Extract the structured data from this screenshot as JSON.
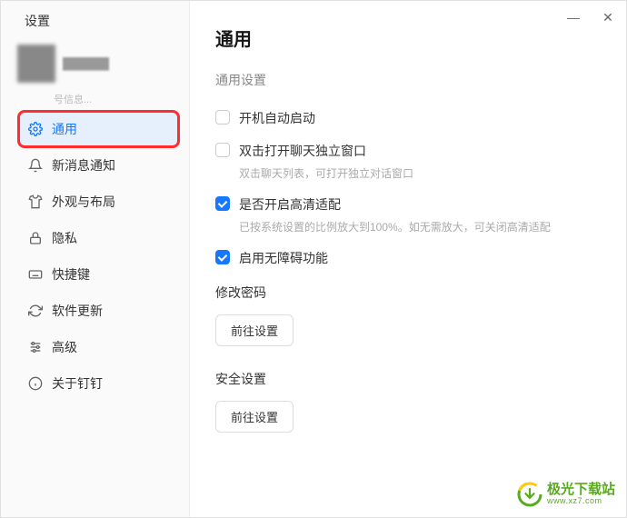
{
  "window": {
    "title": "设置",
    "minimize": "—",
    "close": "✕"
  },
  "profile": {
    "name_masked": "██████",
    "sub": "号信息..."
  },
  "sidebar": {
    "items": [
      {
        "label": "通用",
        "icon": "gear"
      },
      {
        "label": "新消息通知",
        "icon": "bell"
      },
      {
        "label": "外观与布局",
        "icon": "shirt"
      },
      {
        "label": "隐私",
        "icon": "lock"
      },
      {
        "label": "快捷键",
        "icon": "keyboard"
      },
      {
        "label": "软件更新",
        "icon": "refresh"
      },
      {
        "label": "高级",
        "icon": "sliders"
      },
      {
        "label": "关于钉钉",
        "icon": "info"
      }
    ]
  },
  "main": {
    "title": "通用",
    "section_label": "通用设置",
    "options": [
      {
        "label": "开机自动启动",
        "checked": false,
        "desc": ""
      },
      {
        "label": "双击打开聊天独立窗口",
        "checked": false,
        "desc": "双击聊天列表，可打开独立对话窗口"
      },
      {
        "label": "是否开启高清适配",
        "checked": true,
        "desc": "已按系统设置的比例放大到100%。如无需放大，可关闭高清适配"
      },
      {
        "label": "启用无障碍功能",
        "checked": true,
        "desc": ""
      }
    ],
    "password_section": {
      "title": "修改密码",
      "button": "前往设置"
    },
    "security_section": {
      "title": "安全设置",
      "button": "前往设置"
    }
  },
  "watermark": {
    "main": "极光下载站",
    "sub": "www.xz7.com"
  }
}
